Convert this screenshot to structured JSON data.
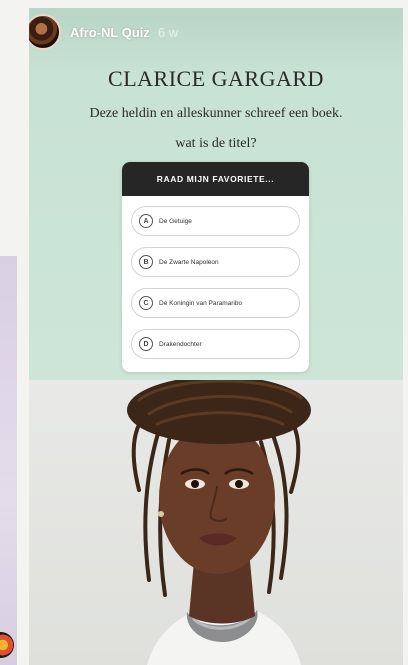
{
  "story": {
    "account_name": "Afro-NL Quiz",
    "posted_age": "6 w",
    "title": "CLARICE GARGARD",
    "subtitle": "Deze heldin en alleskunner schreef een boek.",
    "question": "wat is de titel?"
  },
  "quiz": {
    "header": "RAAD MIJN FAVORIETE...",
    "options": [
      {
        "letter": "A",
        "text": "De Getuige"
      },
      {
        "letter": "B",
        "text": "De Zwarte Napoleon"
      },
      {
        "letter": "C",
        "text": "De Koningin van Paramaribo"
      },
      {
        "letter": "D",
        "text": "Drakendochter"
      }
    ]
  },
  "colors": {
    "story_top_bg": "#cce5d7",
    "quiz_header_bg": "#262626",
    "photo_bg": "#e3e4e1"
  },
  "icons": {
    "account_avatar": "profile-photo",
    "prev_story_avatar": "story-ring-avatar"
  }
}
